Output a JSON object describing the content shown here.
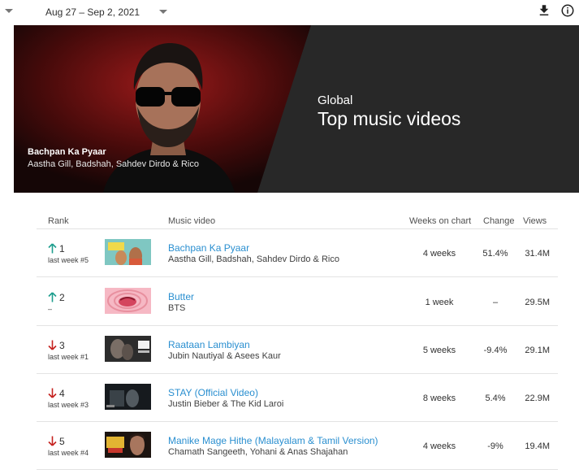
{
  "toolbar": {
    "date_range": "Aug 27 – Sep 2, 2021",
    "download_icon": "download-icon",
    "info_icon": "info-icon"
  },
  "hero": {
    "video_title": "Bachpan Ka Pyaar",
    "video_artists": "Aastha Gill, Badshah, Sahdev Dirdo & Rico",
    "region": "Global",
    "title": "Top music videos"
  },
  "table": {
    "headers": {
      "rank": "Rank",
      "music_video": "Music video",
      "weeks_on_chart": "Weeks on chart",
      "change": "Change",
      "views": "Views"
    },
    "rows": [
      {
        "rank": "1",
        "trend": "up",
        "last_week": "last week #5",
        "title": "Bachpan Ka Pyaar",
        "artists": "Aastha Gill, Badshah, Sahdev Dirdo & Rico",
        "weeks": "4 weeks",
        "change": "51.4%",
        "views": "31.4M"
      },
      {
        "rank": "2",
        "trend": "up",
        "last_week": "–",
        "title": "Butter",
        "artists": "BTS",
        "weeks": "1 week",
        "change": "–",
        "views": "29.5M"
      },
      {
        "rank": "3",
        "trend": "down",
        "last_week": "last week #1",
        "title": "Raataan Lambiyan",
        "artists": "Jubin Nautiyal & Asees Kaur",
        "weeks": "5 weeks",
        "change": "-9.4%",
        "views": "29.1M"
      },
      {
        "rank": "4",
        "trend": "down",
        "last_week": "last week #3",
        "title": "STAY (Official Video)",
        "artists": "Justin Bieber & The Kid Laroi",
        "weeks": "8 weeks",
        "change": "5.4%",
        "views": "22.9M"
      },
      {
        "rank": "5",
        "trend": "down",
        "last_week": "last week #4",
        "title": "Manike Mage Hithe (Malayalam & Tamil Version)",
        "artists": "Chamath Sangeeth, Yohani & Anas Shajahan",
        "weeks": "4 weeks",
        "change": "-9%",
        "views": "19.4M"
      }
    ]
  },
  "colors": {
    "link": "#2a8fd0",
    "trend_up": "#1e9e8e",
    "trend_down": "#c5221f",
    "hero_bg": "#282828"
  }
}
